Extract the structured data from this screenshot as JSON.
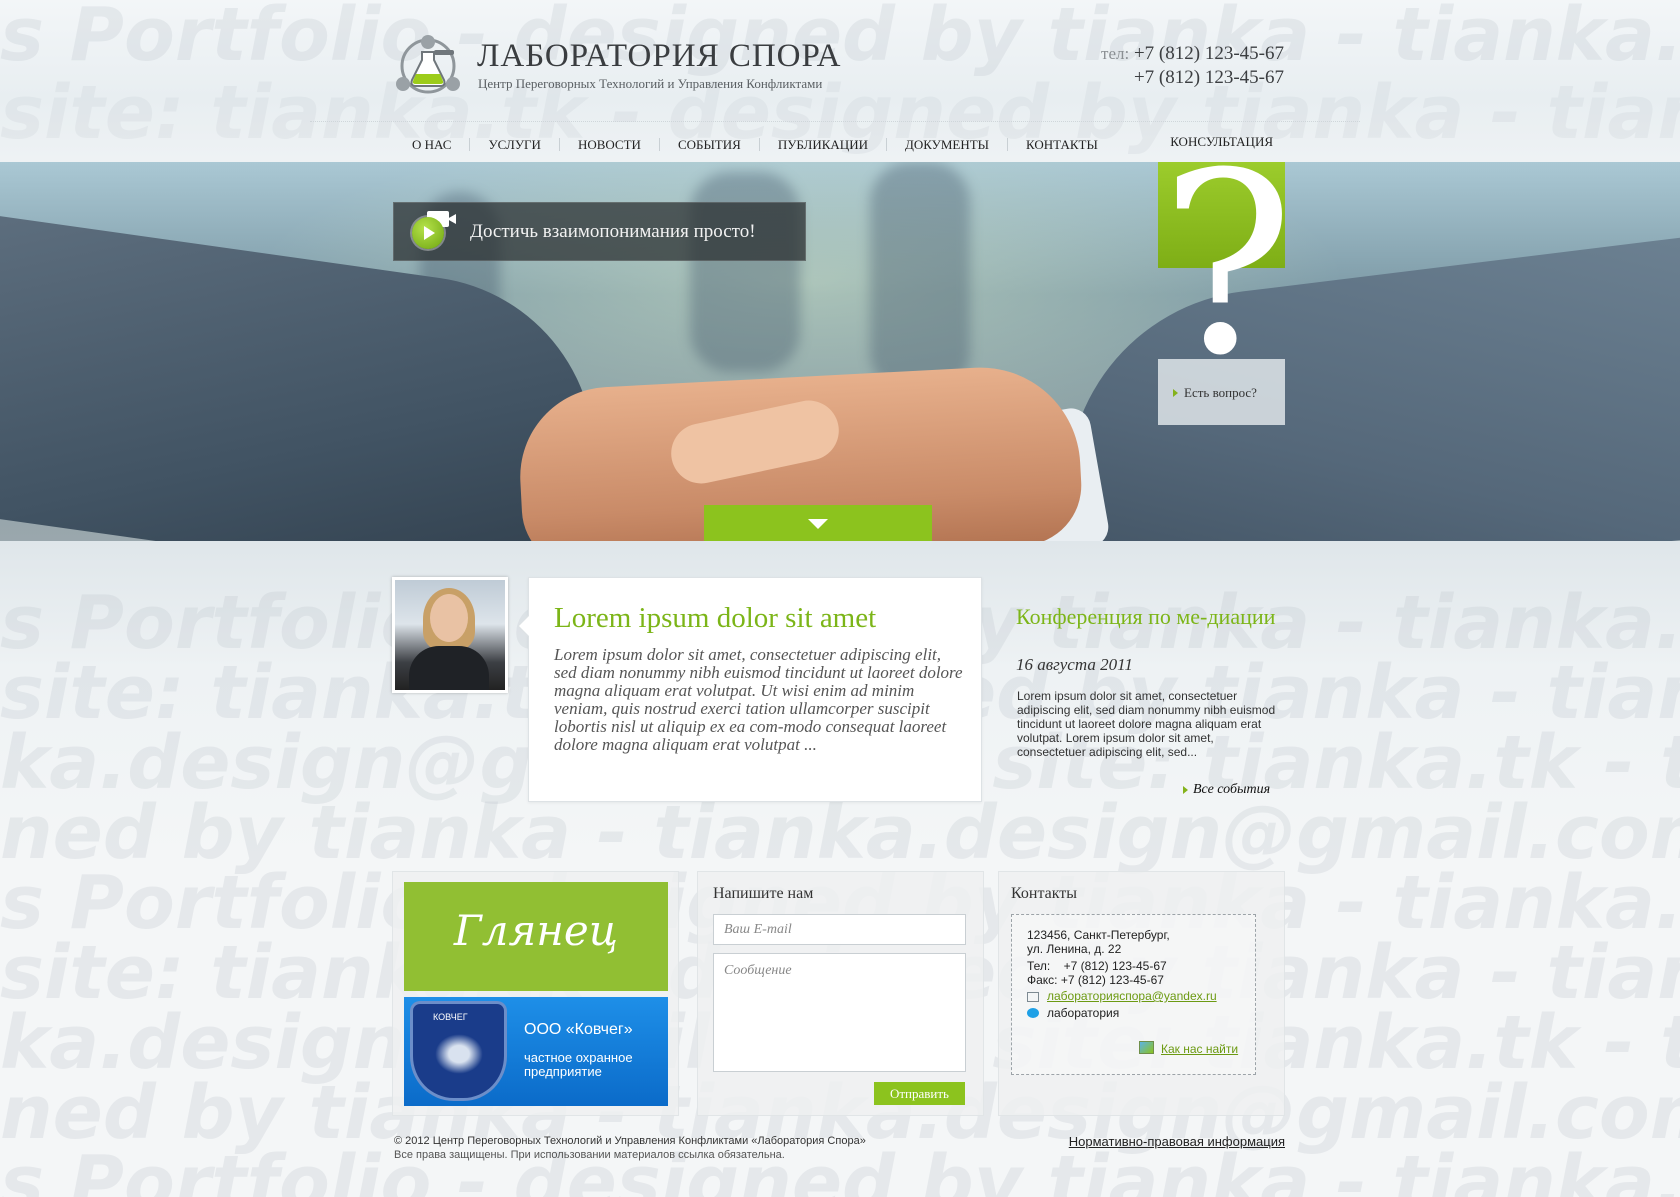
{
  "watermark": {
    "line1": "s Portfolio - designed by tianka - tianka.design@gmail.com",
    "line2": "site: tianka.tk - designed by tianka - tianka.design@gmail.com",
    "line3": "ka.design@gmail.com - site: tianka.tk - tianka s Portfolio",
    "line4": "ned by tianka - tianka.design@gmail.com - site: tianka.tk"
  },
  "header": {
    "brand": "ЛАБОРАТОРИЯ СПОРА",
    "tagline": "Центр Переговорных Технологий и Управления Конфликтами",
    "phone_label": "тел:",
    "phone1": "+7 (812) 123-45-67",
    "phone2": "+7 (812) 123-45-67"
  },
  "nav": {
    "items": [
      "О НАС",
      "УСЛУГИ",
      "НОВОСТИ",
      "СОБЫТИЯ",
      "ПУБЛИКАЦИИ",
      "ДОКУМЕНТЫ",
      "КОНТАКТЫ"
    ],
    "consult": "КОНСУЛЬТАЦИЯ"
  },
  "hero": {
    "video_text": "Достичь взаимопонимания просто!",
    "question_mark": "?",
    "question_link": "Есть вопрос?"
  },
  "quote": {
    "title": "Lorem ipsum dolor sit amet",
    "text": "Lorem ipsum dolor sit amet, consectetuer adipiscing elit, sed diam nonummy nibh euismod tincidunt ut laoreet dolore magna aliquam erat volutpat. Ut wisi enim ad minim veniam, quis nostrud exerci tation ullamcorper suscipit lobortis nisl ut aliquip ex ea com-modo consequat laoreet dolore magna aliquam erat volutpat ..."
  },
  "event": {
    "title": "Конференция по ме-диации",
    "date": "16 августа 2011",
    "text": "Lorem ipsum dolor sit amet, consectetuer adipiscing elit, sed diam nonummy nibh euismod tincidunt ut laoreet dolore magna aliquam erat volutpat. Lorem ipsum dolor sit amet, consectetuer adipiscing elit, sed...",
    "all_link": "Все события"
  },
  "banners": {
    "banner1": "Глянец",
    "banner2_badge": "КОВЧЕГ",
    "banner2_title": "ООО «Ковчег»",
    "banner2_sub": "частное охранное предприятие"
  },
  "form": {
    "heading": "Напишите нам",
    "email_placeholder": "Ваш E-mail",
    "message_placeholder": "Сообщение",
    "submit": "Отправить"
  },
  "contacts": {
    "heading": "Контакты",
    "address1": "123456, Санкт-Петербург,",
    "address2": "ул. Ленина, д. 22",
    "phone_label": "Тел:",
    "phone": "+7 (812) 123-45-67",
    "fax_label": "Факс:",
    "fax": "+7 (812) 123-45-67",
    "email": "лабораторияспора@yandex.ru",
    "skype": "лаборатория",
    "map_link": "Как нас найти"
  },
  "footer": {
    "copyright": "© 2012 Центр Переговорных Технологий и Управления Конфликтами «Лаборатория Спора»",
    "rights": "Все права защищены. При использовании материалов ссылка обязательна.",
    "legal_link": "Нормативно-правовая информация"
  },
  "colors": {
    "accent": "#8cc31e",
    "accent_text": "#7cb518",
    "banner_blue": "#1e8fe8"
  }
}
